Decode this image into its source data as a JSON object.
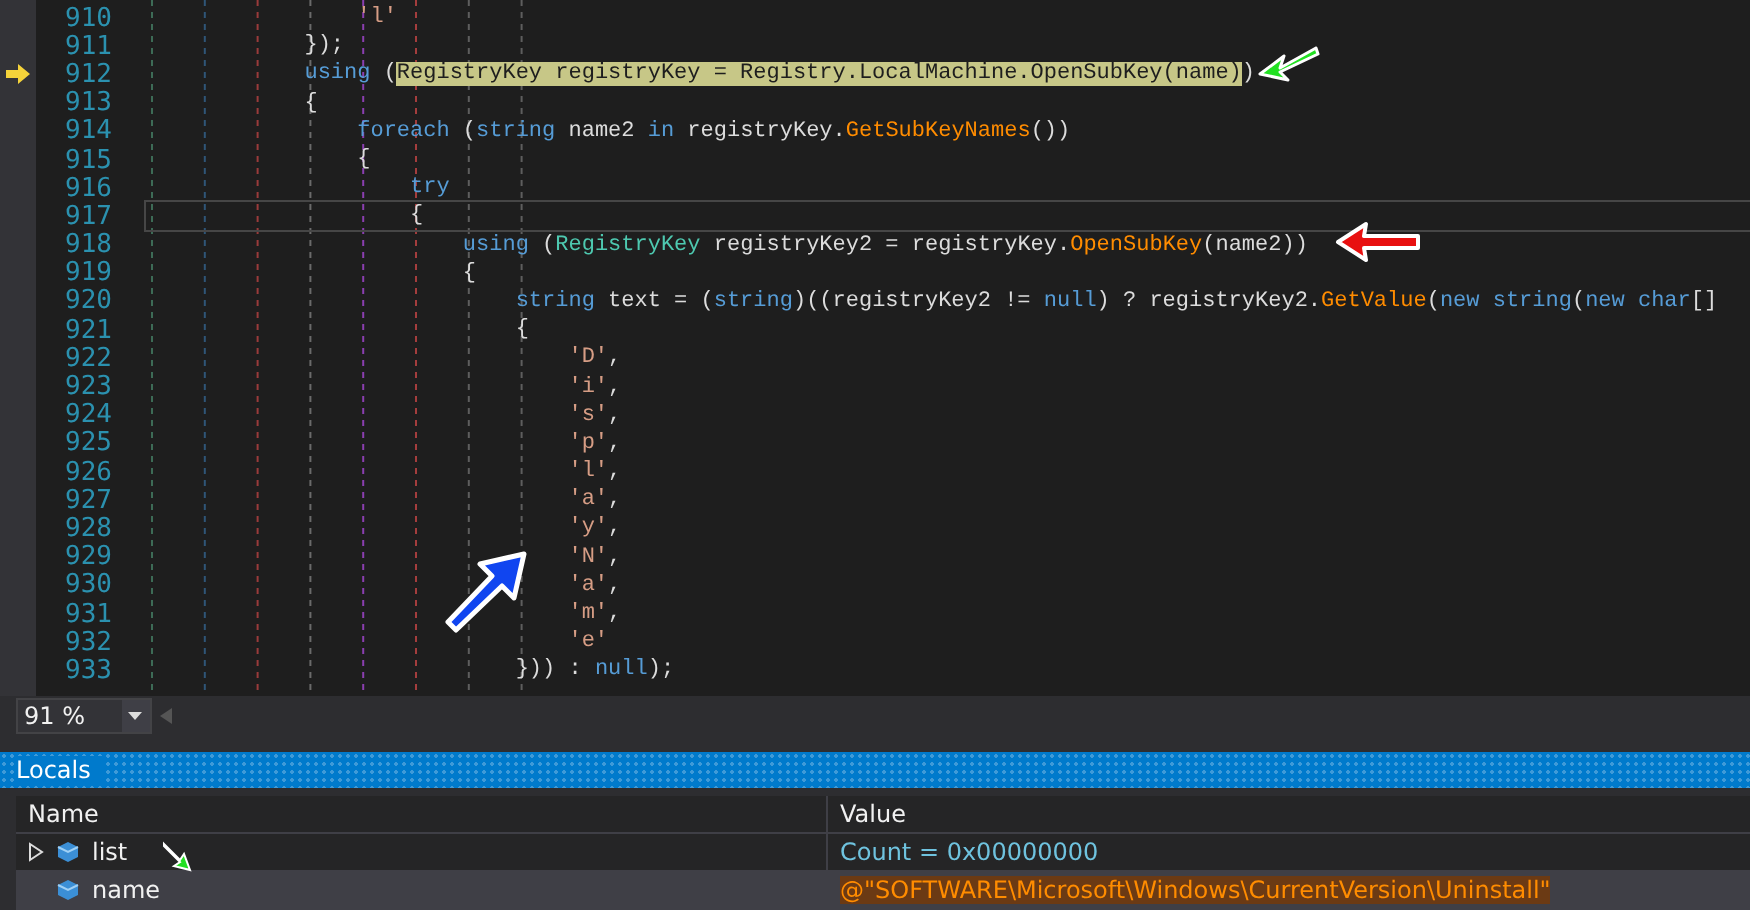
{
  "editor": {
    "lines": [
      {
        "number": "910",
        "current": false,
        "outlined": false,
        "tokens": [
          {
            "text": "                'l'",
            "kind": "string"
          }
        ]
      },
      {
        "number": "911",
        "current": false,
        "outlined": false,
        "tokens": [
          {
            "text": "            });",
            "kind": "plain"
          }
        ]
      },
      {
        "number": "912",
        "current": true,
        "outlined": false,
        "tokens": [
          {
            "text": "            using",
            "kind": "keyword"
          },
          {
            "text": " (",
            "kind": "plain"
          },
          {
            "text": "RegistryKey registryKey = Registry.LocalMachine.OpenSubKey(name)",
            "kind": "highlight"
          },
          {
            "text": ")",
            "kind": "plain"
          }
        ]
      },
      {
        "number": "913",
        "current": false,
        "outlined": false,
        "tokens": [
          {
            "text": "            {",
            "kind": "plain"
          }
        ]
      },
      {
        "number": "914",
        "current": false,
        "outlined": false,
        "tokens": [
          {
            "text": "                foreach",
            "kind": "keyword"
          },
          {
            "text": " (",
            "kind": "plain"
          },
          {
            "text": "string",
            "kind": "keyword"
          },
          {
            "text": " name2 ",
            "kind": "plain"
          },
          {
            "text": "in",
            "kind": "keyword"
          },
          {
            "text": " registryKey.",
            "kind": "plain"
          },
          {
            "text": "GetSubKeyNames",
            "kind": "method"
          },
          {
            "text": "())",
            "kind": "plain"
          }
        ]
      },
      {
        "number": "915",
        "current": false,
        "outlined": false,
        "tokens": [
          {
            "text": "                {",
            "kind": "plain"
          }
        ]
      },
      {
        "number": "916",
        "current": false,
        "outlined": false,
        "tokens": [
          {
            "text": "                    try",
            "kind": "keyword"
          }
        ]
      },
      {
        "number": "917",
        "current": false,
        "outlined": true,
        "tokens": [
          {
            "text": "                    {",
            "kind": "plain"
          }
        ]
      },
      {
        "number": "918",
        "current": false,
        "outlined": false,
        "tokens": [
          {
            "text": "                        using",
            "kind": "keyword"
          },
          {
            "text": " (",
            "kind": "plain"
          },
          {
            "text": "RegistryKey",
            "kind": "type"
          },
          {
            "text": " registryKey2 = registryKey.",
            "kind": "plain"
          },
          {
            "text": "OpenSubKey",
            "kind": "method"
          },
          {
            "text": "(name2))",
            "kind": "plain"
          }
        ]
      },
      {
        "number": "919",
        "current": false,
        "outlined": false,
        "tokens": [
          {
            "text": "                        {",
            "kind": "plain"
          }
        ]
      },
      {
        "number": "920",
        "current": false,
        "outlined": false,
        "tokens": [
          {
            "text": "                            string",
            "kind": "keyword"
          },
          {
            "text": " text = (",
            "kind": "plain"
          },
          {
            "text": "string",
            "kind": "keyword"
          },
          {
            "text": ")((registryKey2 != ",
            "kind": "plain"
          },
          {
            "text": "null",
            "kind": "keyword"
          },
          {
            "text": ") ? registryKey2.",
            "kind": "plain"
          },
          {
            "text": "GetValue",
            "kind": "method"
          },
          {
            "text": "(",
            "kind": "plain"
          },
          {
            "text": "new string",
            "kind": "keyword"
          },
          {
            "text": "(",
            "kind": "plain"
          },
          {
            "text": "new char",
            "kind": "keyword"
          },
          {
            "text": "[]",
            "kind": "plain"
          }
        ]
      },
      {
        "number": "921",
        "current": false,
        "outlined": false,
        "tokens": [
          {
            "text": "                            {",
            "kind": "plain"
          }
        ]
      },
      {
        "number": "922",
        "current": false,
        "outlined": false,
        "tokens": [
          {
            "text": "                                'D'",
            "kind": "string"
          },
          {
            "text": ",",
            "kind": "plain"
          }
        ]
      },
      {
        "number": "923",
        "current": false,
        "outlined": false,
        "tokens": [
          {
            "text": "                                'i'",
            "kind": "string"
          },
          {
            "text": ",",
            "kind": "plain"
          }
        ]
      },
      {
        "number": "924",
        "current": false,
        "outlined": false,
        "tokens": [
          {
            "text": "                                's'",
            "kind": "string"
          },
          {
            "text": ",",
            "kind": "plain"
          }
        ]
      },
      {
        "number": "925",
        "current": false,
        "outlined": false,
        "tokens": [
          {
            "text": "                                'p'",
            "kind": "string"
          },
          {
            "text": ",",
            "kind": "plain"
          }
        ]
      },
      {
        "number": "926",
        "current": false,
        "outlined": false,
        "tokens": [
          {
            "text": "                                'l'",
            "kind": "string"
          },
          {
            "text": ",",
            "kind": "plain"
          }
        ]
      },
      {
        "number": "927",
        "current": false,
        "outlined": false,
        "tokens": [
          {
            "text": "                                'a'",
            "kind": "string"
          },
          {
            "text": ",",
            "kind": "plain"
          }
        ]
      },
      {
        "number": "928",
        "current": false,
        "outlined": false,
        "tokens": [
          {
            "text": "                                'y'",
            "kind": "string"
          },
          {
            "text": ",",
            "kind": "plain"
          }
        ]
      },
      {
        "number": "929",
        "current": false,
        "outlined": false,
        "tokens": [
          {
            "text": "                                'N'",
            "kind": "string"
          },
          {
            "text": ",",
            "kind": "plain"
          }
        ]
      },
      {
        "number": "930",
        "current": false,
        "outlined": false,
        "tokens": [
          {
            "text": "                                'a'",
            "kind": "string"
          },
          {
            "text": ",",
            "kind": "plain"
          }
        ]
      },
      {
        "number": "931",
        "current": false,
        "outlined": false,
        "tokens": [
          {
            "text": "                                'm'",
            "kind": "string"
          },
          {
            "text": ",",
            "kind": "plain"
          }
        ]
      },
      {
        "number": "932",
        "current": false,
        "outlined": false,
        "tokens": [
          {
            "text": "                                'e'",
            "kind": "string"
          }
        ]
      },
      {
        "number": "933",
        "current": false,
        "outlined": false,
        "tokens": [
          {
            "text": "                            })) : ",
            "kind": "plain"
          },
          {
            "text": "null",
            "kind": "keyword"
          },
          {
            "text": ");",
            "kind": "plain"
          }
        ]
      }
    ],
    "zoom": "91 %"
  },
  "locals": {
    "title": "Locals",
    "columns": [
      "Name",
      "Value"
    ],
    "rows": [
      {
        "name": "list",
        "value": "Count = 0x00000000",
        "kind": "object",
        "expandable": true,
        "selected": false
      },
      {
        "name": "name",
        "value": "@\"SOFTWARE\\Microsoft\\Windows\\CurrentVersion\\Uninstall\"",
        "kind": "string",
        "expandable": false,
        "selected": true
      }
    ]
  }
}
